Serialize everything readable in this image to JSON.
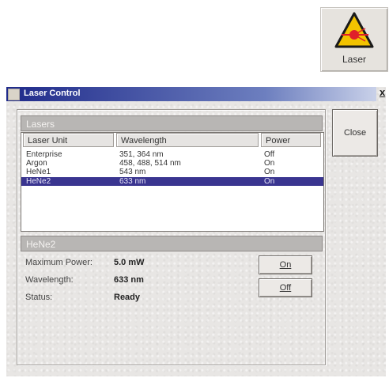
{
  "desktop_icon": {
    "label": "Laser",
    "icon": "laser-warning-icon"
  },
  "window": {
    "title": "Laser Control",
    "close_glyph": "x",
    "close_button_label": "Close"
  },
  "lasers_panel": {
    "header": "Lasers",
    "columns": [
      "Laser Unit",
      "Wavelength",
      "Power"
    ],
    "rows": [
      {
        "unit": "Enterprise",
        "wavelength": "351, 364 nm",
        "power": "Off",
        "selected": false
      },
      {
        "unit": "Argon",
        "wavelength": "458, 488, 514 nm",
        "power": "On",
        "selected": false
      },
      {
        "unit": "HeNe1",
        "wavelength": "543 nm",
        "power": "On",
        "selected": false
      },
      {
        "unit": "HeNe2",
        "wavelength": "633 nm",
        "power": "On",
        "selected": true
      }
    ]
  },
  "detail_panel": {
    "header": "HeNe2",
    "fields": [
      {
        "label": "Maximum Power:",
        "value": "5.0 mW"
      },
      {
        "label": "Wavelength:",
        "value": "633 nm"
      },
      {
        "label": "Status:",
        "value": "Ready"
      }
    ],
    "on_button": "On",
    "off_button": "Off"
  },
  "colors": {
    "titlebar_start": "#1f2a8a",
    "selection": "#3a3590",
    "warning_triangle": "#f2c300",
    "laser_red": "#e0202a"
  }
}
